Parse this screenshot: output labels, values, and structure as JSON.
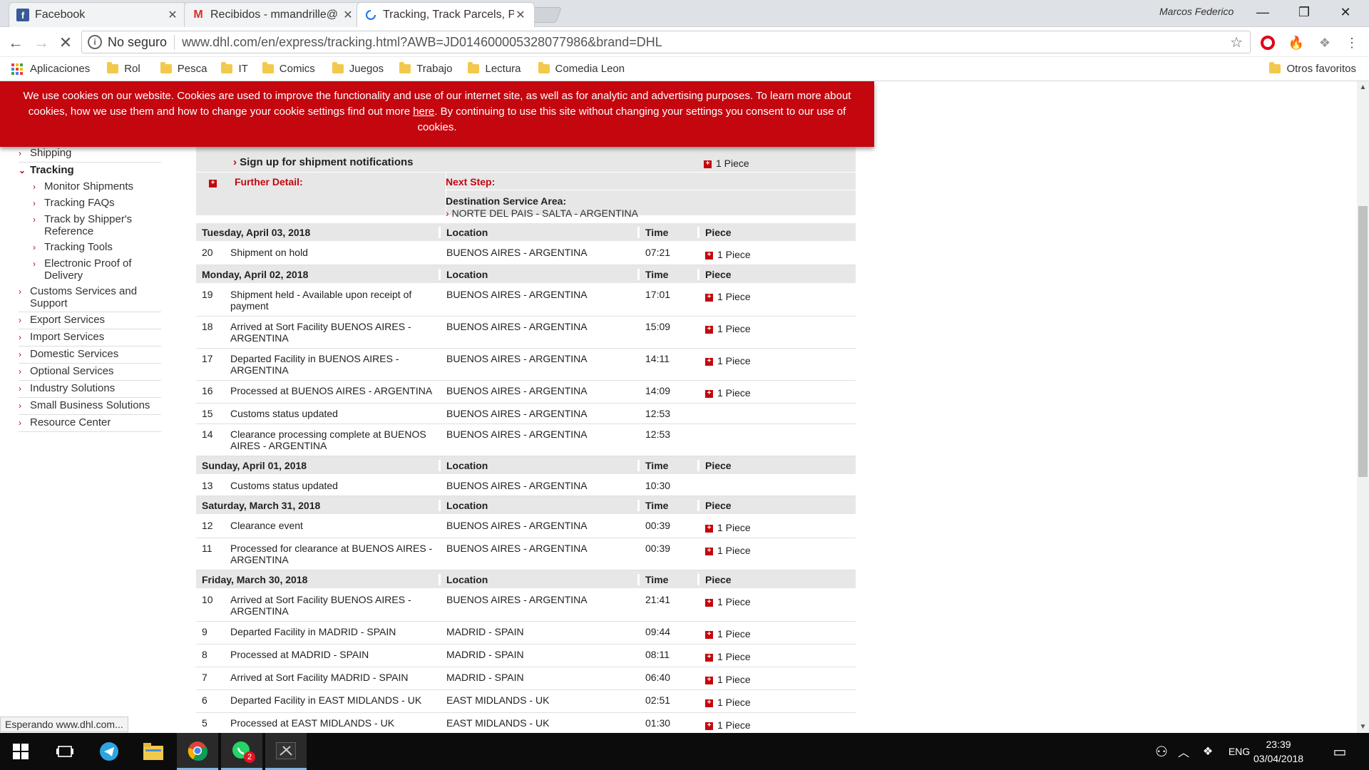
{
  "tabs": [
    {
      "title": "Facebook",
      "icon": "facebook-icon"
    },
    {
      "title": "Recibidos - mmandrille@",
      "icon": "gmail-icon"
    },
    {
      "title": "Tracking, Track Parcels, P",
      "icon": "loading-icon"
    }
  ],
  "profile_name": "Marcos Federico",
  "omnibox": {
    "security": "No seguro",
    "url": "www.dhl.com/en/express/tracking.html?AWB=JD014600005328077986&brand=DHL"
  },
  "bookmarks": {
    "apps": "Aplicaciones",
    "folders": [
      "Rol",
      "Pesca",
      "IT",
      "Comics",
      "Juegos",
      "Trabajo",
      "Lectura",
      "Comedia Leon"
    ],
    "other": "Otros favoritos"
  },
  "cookie": {
    "text_before": "We use cookies on our website. Cookies are used to improve the functionality and use of our internet site, as well as for analytic and advertising purposes. To learn more about cookies, how we use them and how to change your cookie settings find out more ",
    "link": "here",
    "text_after": ". By continuing to use this site without changing your settings you consent to our use of cookies."
  },
  "leftnav": [
    {
      "label": "Shipping",
      "level": 0
    },
    {
      "label": "Tracking",
      "level": 0,
      "bold": true,
      "open": true
    },
    {
      "label": "Monitor Shipments",
      "level": 1
    },
    {
      "label": "Tracking FAQs",
      "level": 1
    },
    {
      "label": "Track by Shipper's Reference",
      "level": 1
    },
    {
      "label": "Tracking Tools",
      "level": 1
    },
    {
      "label": "Electronic Proof of Delivery",
      "level": 1
    },
    {
      "label": "Customs Services and Support",
      "level": 0
    },
    {
      "label": "Export Services",
      "level": 0
    },
    {
      "label": "Import Services",
      "level": 0
    },
    {
      "label": "Domestic Services",
      "level": 0
    },
    {
      "label": "Optional Services",
      "level": 0
    },
    {
      "label": "Industry Solutions",
      "level": 0
    },
    {
      "label": "Small Business Solutions",
      "level": 0
    },
    {
      "label": "Resource Center",
      "level": 0
    }
  ],
  "info": {
    "signup": "Sign up for shipment notifications",
    "piece": "1 Piece",
    "further": "Further Detail:",
    "next_step": "Next Step:",
    "dest_label": "Destination Service Area:",
    "dest_value": "NORTE DEL PAIS - SALTA - ARGENTINA"
  },
  "columns": {
    "location": "Location",
    "time": "Time",
    "piece": "Piece"
  },
  "groups": [
    {
      "date": "Tuesday, April 03, 2018",
      "events": [
        {
          "n": "20",
          "desc": "Shipment on hold",
          "loc": "BUENOS AIRES - ARGENTINA",
          "time": "07:21",
          "piece": "1 Piece"
        }
      ]
    },
    {
      "date": "Monday, April 02, 2018",
      "events": [
        {
          "n": "19",
          "desc": "Shipment held - Available upon receipt of payment",
          "loc": "BUENOS AIRES - ARGENTINA",
          "time": "17:01",
          "piece": "1 Piece"
        },
        {
          "n": "18",
          "desc": "Arrived at Sort Facility BUENOS AIRES - ARGENTINA",
          "loc": "BUENOS AIRES - ARGENTINA",
          "time": "15:09",
          "piece": "1 Piece"
        },
        {
          "n": "17",
          "desc": "Departed Facility in BUENOS AIRES - ARGENTINA",
          "loc": "BUENOS AIRES - ARGENTINA",
          "time": "14:11",
          "piece": "1 Piece"
        },
        {
          "n": "16",
          "desc": "Processed at BUENOS AIRES - ARGENTINA",
          "loc": "BUENOS AIRES - ARGENTINA",
          "time": "14:09",
          "piece": "1 Piece"
        },
        {
          "n": "15",
          "desc": "Customs status updated",
          "loc": "BUENOS AIRES - ARGENTINA",
          "time": "12:53",
          "piece": ""
        },
        {
          "n": "14",
          "desc": "Clearance processing complete at BUENOS AIRES - ARGENTINA",
          "loc": "BUENOS AIRES - ARGENTINA",
          "time": "12:53",
          "piece": ""
        }
      ]
    },
    {
      "date": "Sunday, April 01, 2018",
      "events": [
        {
          "n": "13",
          "desc": "Customs status updated",
          "loc": "BUENOS AIRES - ARGENTINA",
          "time": "10:30",
          "piece": ""
        }
      ]
    },
    {
      "date": "Saturday, March 31, 2018",
      "events": [
        {
          "n": "12",
          "desc": "Clearance event",
          "loc": "BUENOS AIRES - ARGENTINA",
          "time": "00:39",
          "piece": "1 Piece"
        },
        {
          "n": "11",
          "desc": "Processed for clearance at BUENOS AIRES - ARGENTINA",
          "loc": "BUENOS AIRES - ARGENTINA",
          "time": "00:39",
          "piece": "1 Piece"
        }
      ]
    },
    {
      "date": "Friday, March 30, 2018",
      "events": [
        {
          "n": "10",
          "desc": "Arrived at Sort Facility BUENOS AIRES - ARGENTINA",
          "loc": "BUENOS AIRES - ARGENTINA",
          "time": "21:41",
          "piece": "1 Piece"
        },
        {
          "n": "9",
          "desc": "Departed Facility in MADRID - SPAIN",
          "loc": "MADRID - SPAIN",
          "time": "09:44",
          "piece": "1 Piece"
        },
        {
          "n": "8",
          "desc": "Processed at MADRID - SPAIN",
          "loc": "MADRID - SPAIN",
          "time": "08:11",
          "piece": "1 Piece"
        },
        {
          "n": "7",
          "desc": "Arrived at Sort Facility MADRID - SPAIN",
          "loc": "MADRID - SPAIN",
          "time": "06:40",
          "piece": "1 Piece"
        },
        {
          "n": "6",
          "desc": "Departed Facility in EAST MIDLANDS - UK",
          "loc": "EAST MIDLANDS - UK",
          "time": "02:51",
          "piece": "1 Piece"
        },
        {
          "n": "5",
          "desc": "Processed at EAST MIDLANDS - UK",
          "loc": "EAST MIDLANDS - UK",
          "time": "01:30",
          "piece": "1 Piece"
        }
      ]
    },
    {
      "date": "",
      "events": []
    }
  ],
  "status_text": "Esperando www.dhl.com...",
  "taskbar": {
    "lang": "ENG",
    "time": "23:39",
    "date": "03/04/2018",
    "whatsapp_badge": "2"
  },
  "colors": {
    "dhl_red": "#c4060f",
    "facebook_blue": "#3b5998"
  }
}
